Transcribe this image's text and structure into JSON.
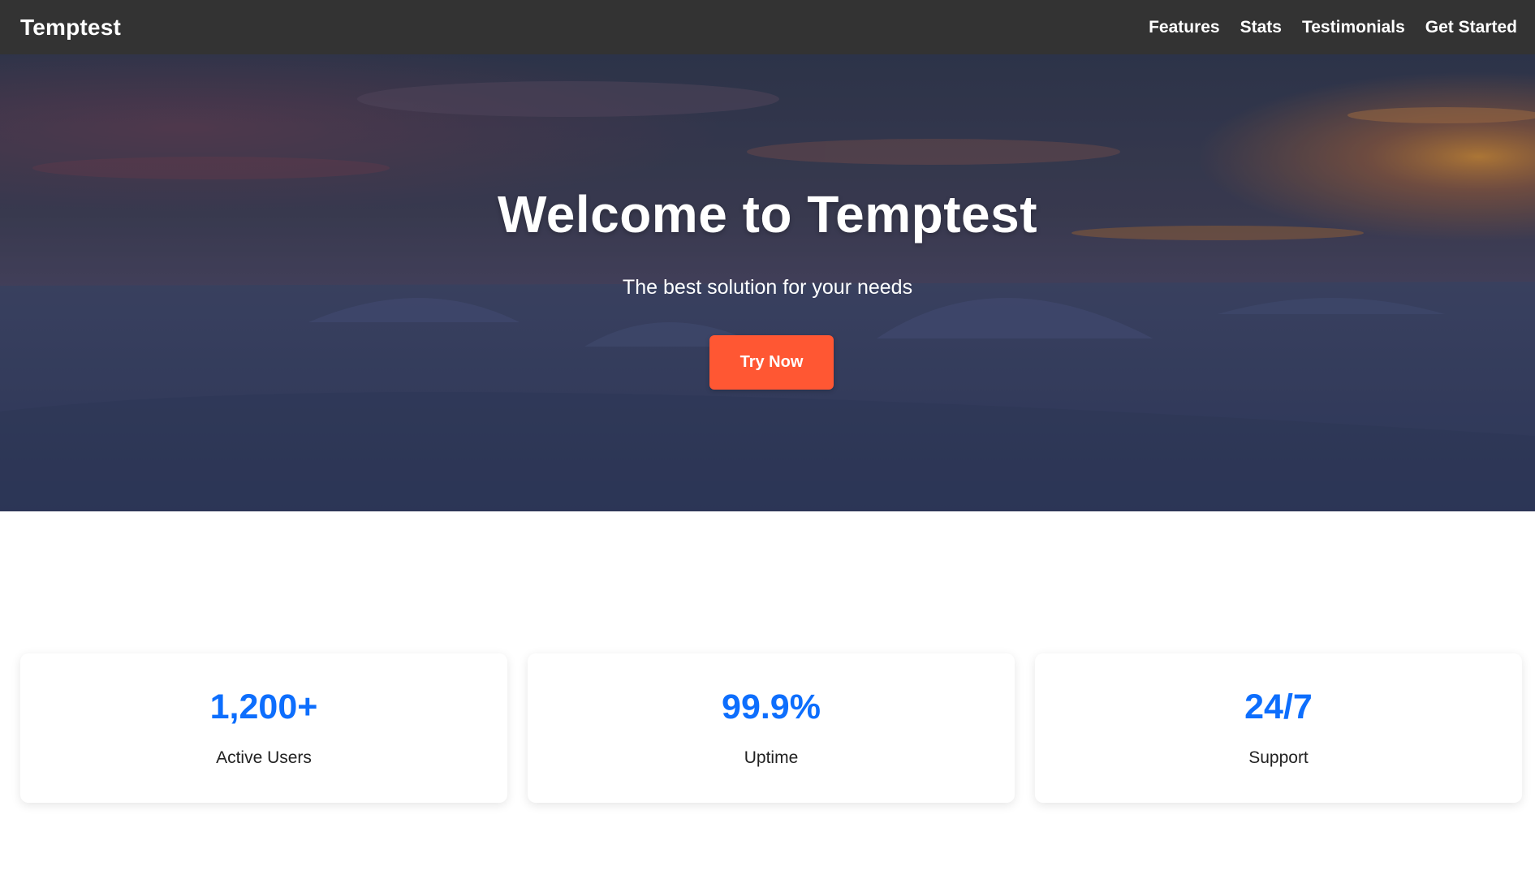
{
  "navbar": {
    "brand": "Temptest",
    "links": [
      {
        "label": "Features"
      },
      {
        "label": "Stats"
      },
      {
        "label": "Testimonials"
      },
      {
        "label": "Get Started"
      }
    ]
  },
  "hero": {
    "title": "Welcome to Temptest",
    "subtitle": "The best solution for your needs",
    "cta_label": "Try Now"
  },
  "stats": [
    {
      "value": "1,200+",
      "label": "Active Users"
    },
    {
      "value": "99.9%",
      "label": "Uptime"
    },
    {
      "value": "24/7",
      "label": "Support"
    }
  ],
  "colors": {
    "navbar_bg": "#333333",
    "cta": "#ff5733",
    "stat_value": "#0d6efd"
  }
}
